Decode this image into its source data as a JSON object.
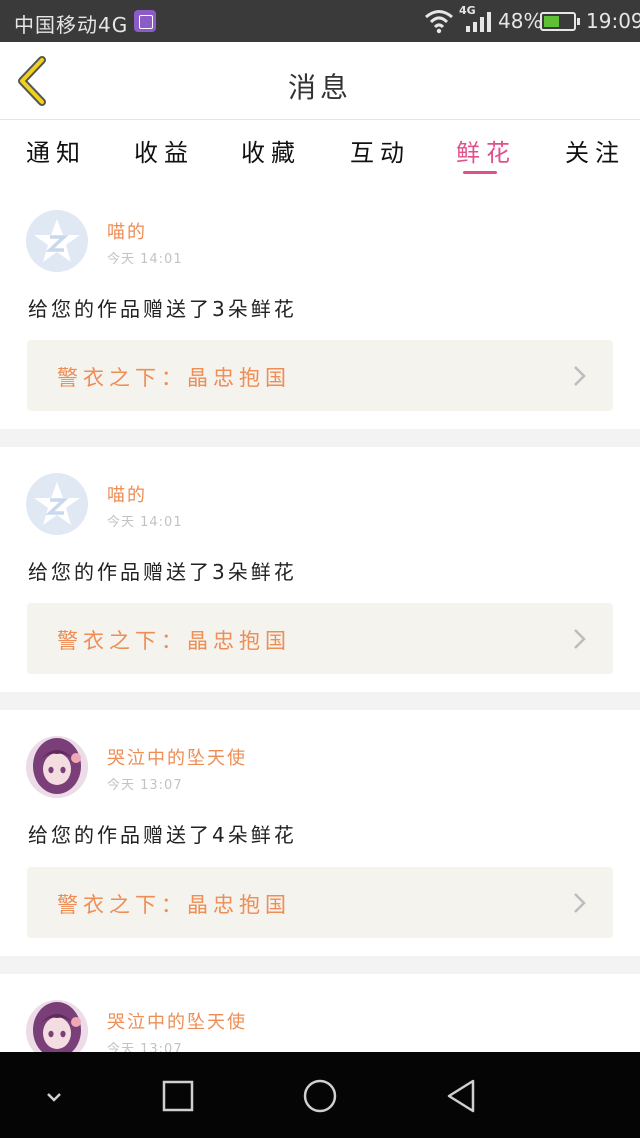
{
  "status_bar": {
    "carrier": "中国移动4G",
    "network": "4G",
    "battery": "48%",
    "time": "19:09"
  },
  "header": {
    "title": "消息"
  },
  "tabs": [
    {
      "label": "通知"
    },
    {
      "label": "收益"
    },
    {
      "label": "收藏"
    },
    {
      "label": "互动"
    },
    {
      "label": "鲜花"
    },
    {
      "label": "关注"
    }
  ],
  "active_tab": "鲜花",
  "colors": {
    "accent_pink": "#e0508c",
    "accent_orange": "#ee8d55",
    "card_tint": "#f4f3ee"
  },
  "messages": [
    {
      "user": "喵的",
      "time": "今天 14:01",
      "text": "给您的作品赠送了3朵鲜花",
      "work": "警衣之下：晶忠抱国",
      "avatar": "qq-avatar"
    },
    {
      "user": "喵的",
      "time": "今天 14:01",
      "text": "给您的作品赠送了3朵鲜花",
      "work": "警衣之下：晶忠抱国",
      "avatar": "qq-avatar"
    },
    {
      "user": "哭泣中的坠天使",
      "time": "今天 13:07",
      "text": "给您的作品赠送了4朵鲜花",
      "work": "警衣之下：晶忠抱国",
      "avatar": "anime-girl-avatar"
    },
    {
      "user": "哭泣中的坠天使",
      "time": "今天 13:07",
      "avatar": "anime-girl-avatar"
    }
  ]
}
